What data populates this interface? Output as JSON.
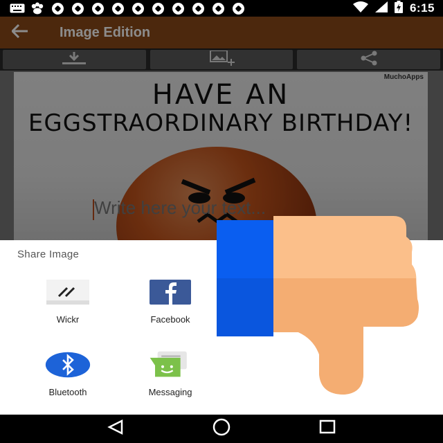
{
  "status_bar": {
    "time": "6:15",
    "left_icons": [
      "keyboard-icon",
      "paw-icon",
      "soccer-ball-icon",
      "soccer-ball-icon",
      "soccer-ball-icon",
      "soccer-ball-icon",
      "soccer-ball-icon",
      "soccer-ball-icon",
      "soccer-ball-icon",
      "soccer-ball-icon",
      "soccer-ball-icon",
      "soccer-ball-icon"
    ],
    "right_icons": [
      "wifi-icon",
      "signal-icon",
      "battery-charging-icon"
    ]
  },
  "app_bar": {
    "title": "Image Edition",
    "back_icon": "arrow-back-icon",
    "color": "#8a4a18"
  },
  "toolbar": {
    "buttons": [
      "download-icon",
      "add-image-icon",
      "share-icon"
    ]
  },
  "editor": {
    "watermark": "MuchoApps",
    "greeting_line1": "HAVE AN",
    "greeting_line2": "EGGSTRAORDINARY BIRTHDAY!",
    "text_placeholder": "Write here your text..."
  },
  "share_sheet": {
    "title": "Share Image",
    "items": [
      {
        "label": "Wickr",
        "icon": "wickr-icon"
      },
      {
        "label": "Facebook",
        "icon": "facebook-icon"
      },
      {
        "label": "Bluetooth",
        "icon": "bluetooth-icon"
      },
      {
        "label": "Messaging",
        "icon": "messaging-icon"
      }
    ]
  },
  "nav_bar": {
    "buttons": [
      "back-triangle-icon",
      "home-circle-icon",
      "recents-square-icon"
    ]
  },
  "overlay": {
    "icon": "thumbs-down-icon",
    "cuff_color": "#0a5ef0",
    "hand_color": "#fbbf8a"
  }
}
